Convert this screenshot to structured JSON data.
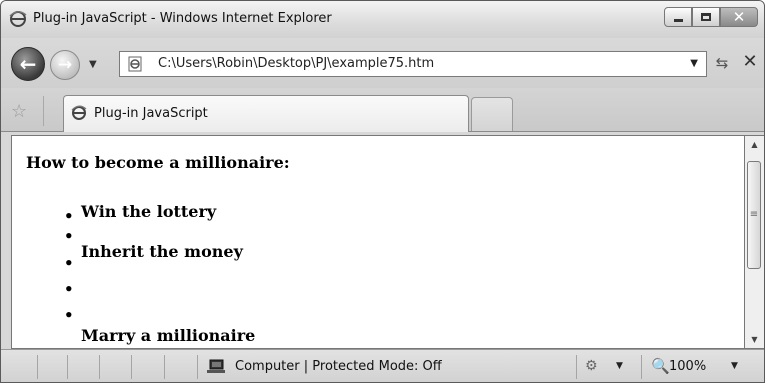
{
  "window": {
    "title": "Plug-in JavaScript - Windows Internet Explorer",
    "icon": "ie-icon",
    "minimize_icon": "minimize-icon",
    "maximize_icon": "maximize-icon",
    "close_glyph": "✕"
  },
  "navigation": {
    "back_glyph": "←",
    "forward_glyph": "→",
    "dropdown_glyph": "▼",
    "address": "C:\\Users\\Robin\\Desktop\\PJ\\example75.htm",
    "address_dropdown_glyph": "▼",
    "refresh_glyph": "⇆",
    "stop_glyph": "✕"
  },
  "tabs": {
    "favorites_glyph": "☆",
    "items": [
      {
        "label": "Plug-in JavaScript",
        "active": true
      }
    ]
  },
  "page": {
    "heading": "How to become a millionaire:",
    "bullet_glyph": "•",
    "list_items": [
      "Win the lottery",
      "Inherit the money",
      "Marry a millionaire"
    ]
  },
  "scrollbar": {
    "up_glyph": "▲",
    "down_glyph": "▼",
    "grip_glyph": "≡"
  },
  "statusbar": {
    "zone_text": "Computer | Protected Mode: Off",
    "globe_glyph": "⚙",
    "globe_dropdown_glyph": "▼",
    "zoom_icon_glyph": "🔍",
    "zoom": "100%",
    "zoom_dropdown_glyph": "▼"
  }
}
